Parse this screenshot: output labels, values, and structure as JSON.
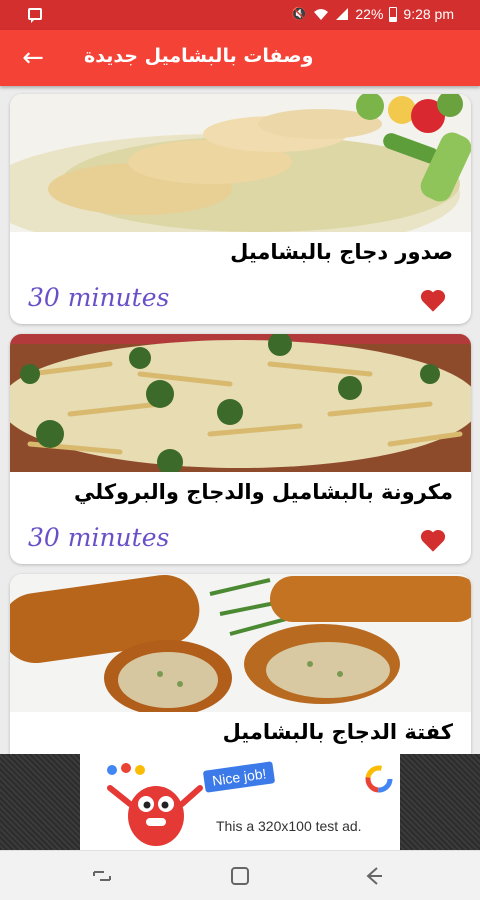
{
  "status_bar": {
    "battery_percent": "22%",
    "time": "9:28 pm",
    "icons": [
      "message-icon",
      "mute-icon",
      "wifi-icon",
      "signal-icon",
      "battery-icon"
    ]
  },
  "app_bar": {
    "title": "وصفات بالبشاميل جديدة",
    "back_icon": "arrow-back-icon"
  },
  "recipes": [
    {
      "title": "صدور دجاج بالبشاميل",
      "time": "30 minutes",
      "image": "chicken-breast-bechamel",
      "favorite": true
    },
    {
      "title": "مكرونة بالبشاميل والدجاج والبروكلي",
      "time": "30 minutes",
      "image": "pasta-bechamel-broccoli",
      "favorite": true
    },
    {
      "title": "كفتة الدجاج بالبشاميل",
      "time": "",
      "image": "chicken-croquettes",
      "favorite": true
    }
  ],
  "ad": {
    "badge": "Nice job!",
    "text": "This a 320x100 test ad."
  },
  "nav_bar": {
    "buttons": [
      "recents-icon",
      "home-icon",
      "back-icon"
    ]
  },
  "colors": {
    "status_bar": "#d32f2f",
    "app_bar": "#f44336",
    "time_text": "#6a50c8",
    "heart": "#d32f2f"
  }
}
